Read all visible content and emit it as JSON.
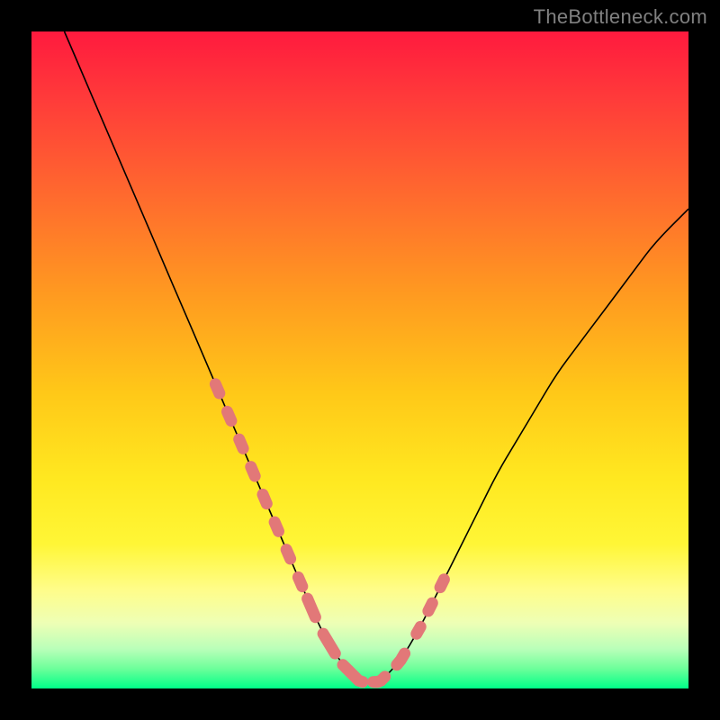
{
  "attribution": "TheBottleneck.com",
  "colors": {
    "background": "#000000",
    "attribution_text": "#808080",
    "curve": "#000000",
    "dots": "#e27878",
    "gradient_top": "#ff1a3e",
    "gradient_bottom": "#00ff88"
  },
  "chart_data": {
    "type": "line",
    "title": "",
    "xlabel": "",
    "ylabel": "",
    "xlim": [
      0,
      100
    ],
    "ylim": [
      0,
      100
    ],
    "grid": false,
    "note": "x is relative horizontal position (0=left,100=right); y is curve height (0=bottom,100=top). Values read from pixel positions of the plotted V-shaped curve.",
    "series": [
      {
        "name": "bottleneck-curve",
        "x": [
          5,
          8,
          11,
          14,
          17,
          20,
          23,
          26,
          29,
          32,
          35,
          38,
          41,
          44,
          47,
          50,
          53,
          56,
          59,
          62,
          65,
          68,
          71,
          74,
          77,
          80,
          83,
          86,
          89,
          92,
          95,
          100
        ],
        "y": [
          100,
          93,
          86,
          79,
          72,
          65,
          58,
          51,
          44,
          37,
          30,
          23,
          16,
          9,
          4,
          1,
          1,
          4,
          9,
          15,
          21,
          27,
          33,
          38,
          43,
          48,
          52,
          56,
          60,
          64,
          68,
          73
        ]
      }
    ],
    "highlight_segments": {
      "note": "Pink dotted overlay segments along the curve near the minimum and lower arms.",
      "left_arm_x_range": [
        28,
        42
      ],
      "right_arm_x_range": [
        52,
        64
      ],
      "trough_x_range": [
        42,
        53
      ]
    }
  }
}
